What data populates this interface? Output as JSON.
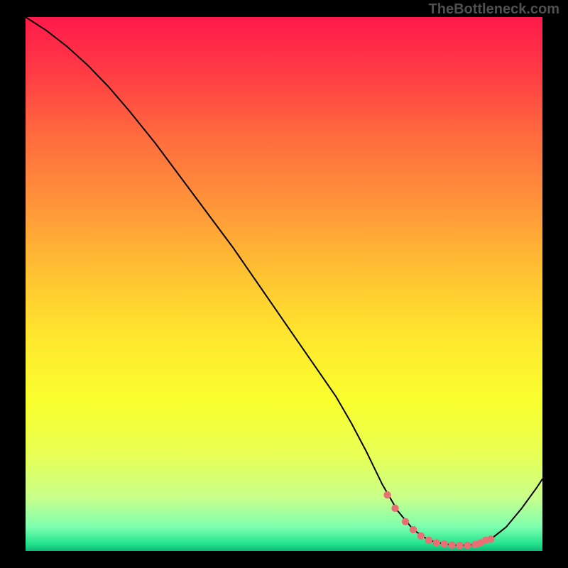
{
  "watermark": "TheBottleneck.com",
  "chart_data": {
    "type": "line",
    "title": "",
    "xlabel": "",
    "ylabel": "",
    "xlim": [
      0,
      100
    ],
    "ylim": [
      0,
      100
    ],
    "background_gradient": {
      "stops": [
        {
          "offset": 0.0,
          "color": "#ff1a4b"
        },
        {
          "offset": 0.1,
          "color": "#ff3a45"
        },
        {
          "offset": 0.22,
          "color": "#ff6a3e"
        },
        {
          "offset": 0.35,
          "color": "#ff943a"
        },
        {
          "offset": 0.48,
          "color": "#ffc232"
        },
        {
          "offset": 0.6,
          "color": "#ffe72e"
        },
        {
          "offset": 0.72,
          "color": "#f9ff2e"
        },
        {
          "offset": 0.82,
          "color": "#e8ff55"
        },
        {
          "offset": 0.9,
          "color": "#c8ff8a"
        },
        {
          "offset": 0.955,
          "color": "#7dffb0"
        },
        {
          "offset": 0.985,
          "color": "#28e58f"
        },
        {
          "offset": 1.0,
          "color": "#0dbb78"
        }
      ]
    },
    "series": [
      {
        "name": "bottleneck-curve",
        "stroke": "#000000",
        "stroke_width": 2,
        "x": [
          0.0,
          4.0,
          8.0,
          12.0,
          16.0,
          20.0,
          25.0,
          30.0,
          35.0,
          40.0,
          45.0,
          50.0,
          55.0,
          60.0,
          63.0,
          66.0,
          69.0,
          72.0,
          75.0,
          78.0,
          81.0,
          84.0,
          87.0,
          90.0,
          93.0,
          96.0,
          99.0,
          100.0
        ],
        "y": [
          100.0,
          97.5,
          94.5,
          91.0,
          87.0,
          82.5,
          76.5,
          70.0,
          63.5,
          57.0,
          50.0,
          43.0,
          36.0,
          29.0,
          24.0,
          18.5,
          12.5,
          7.5,
          4.0,
          2.0,
          1.3,
          1.0,
          1.2,
          2.2,
          4.5,
          8.0,
          12.0,
          13.5
        ]
      }
    ],
    "markers": {
      "name": "sweet-spot-dots",
      "color": "#e86f74",
      "radius": 5.2,
      "x": [
        70.0,
        71.5,
        73.5,
        75.0,
        76.5,
        78.0,
        79.5,
        81.0,
        82.5,
        84.0,
        85.5,
        87.0,
        88.0,
        89.0,
        90.0
      ],
      "y": [
        10.5,
        8.0,
        5.5,
        4.0,
        2.8,
        2.0,
        1.5,
        1.3,
        1.1,
        1.0,
        1.05,
        1.2,
        1.5,
        2.0,
        2.2
      ]
    }
  }
}
